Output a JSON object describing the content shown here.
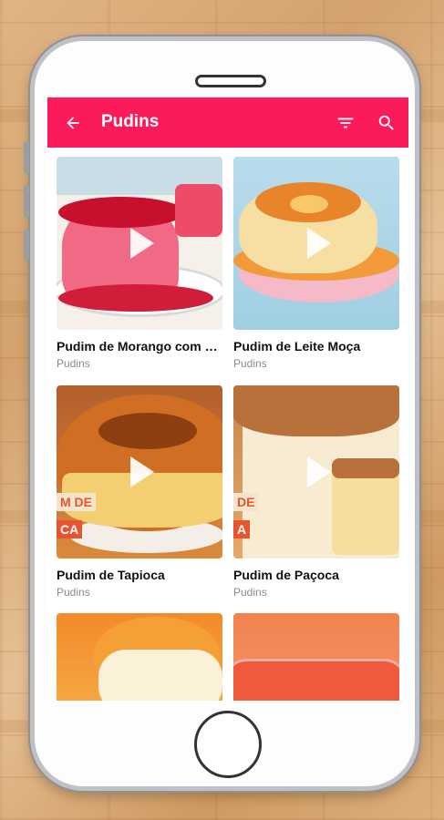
{
  "appbar": {
    "title": "Pudins",
    "color": "#fb1b5a",
    "back_icon": "arrow-back-icon",
    "filter_icon": "filter-icon",
    "search_icon": "search-icon"
  },
  "recipes": [
    {
      "title": "Pudim de Morango com C...",
      "category": "Pudins"
    },
    {
      "title": "Pudim de Leite Moça",
      "category": "Pudins"
    },
    {
      "title": "Pudim de Tapioca",
      "category": "Pudins",
      "overlay": [
        "M DE",
        "CA"
      ]
    },
    {
      "title": "Pudim de Paçoca",
      "category": "Pudins",
      "overlay": [
        "DE",
        "A"
      ]
    },
    {
      "title": "",
      "category": ""
    },
    {
      "title": "",
      "category": ""
    }
  ]
}
